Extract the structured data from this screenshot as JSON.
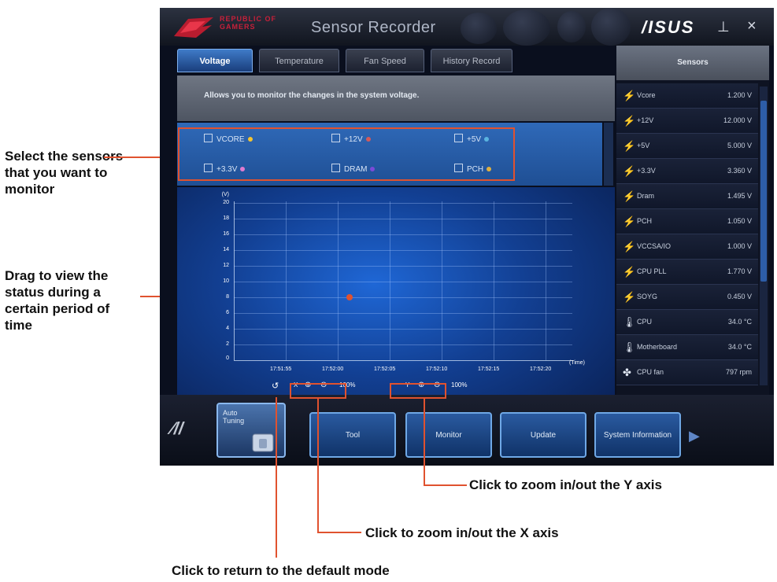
{
  "window": {
    "brand_line1": "REPUBLIC OF",
    "brand_line2": "GAMERS",
    "title": "Sensor Recorder",
    "asus_logo": "/ISUS",
    "minimize_icon": "⊥",
    "close_icon": "×"
  },
  "tabs": [
    {
      "label": "Voltage",
      "active": true
    },
    {
      "label": "Temperature"
    },
    {
      "label": "Fan Speed"
    },
    {
      "label": "History Record"
    }
  ],
  "description": "Allows you to monitor the changes in the system voltage.",
  "sensor_checkboxes": [
    {
      "label": "VCORE",
      "dot_color": "#f4c430"
    },
    {
      "label": "+12V",
      "dot_color": "#d45a5a"
    },
    {
      "label": "+5V",
      "dot_color": "#5ab4e0"
    },
    {
      "label": "+3.3V",
      "dot_color": "#e07bd0"
    },
    {
      "label": "DRAM",
      "dot_color": "#7b4ad8"
    },
    {
      "label": "PCH",
      "dot_color": "#e0b040"
    }
  ],
  "graph": {
    "y_unit": "(V)",
    "y_ticks": [
      "20",
      "18",
      "16",
      "14",
      "12",
      "10",
      "8",
      "6",
      "4",
      "2",
      "0"
    ],
    "x_ticks": [
      "17:51:55",
      "17:52:00",
      "17:52:05",
      "17:52:10",
      "17:52:15",
      "17:52:20"
    ],
    "x_unit": "(Time)",
    "reset_icon": "↺",
    "x_zoom_label": "X",
    "x_zoom_pct": "100%",
    "y_zoom_label": "Y",
    "y_zoom_pct": "100%"
  },
  "right_panel": {
    "header": "Sensors",
    "rows": [
      {
        "icon": "⚡",
        "name": "Vcore",
        "value": "1.200 V"
      },
      {
        "icon": "⚡",
        "name": "+12V",
        "value": "12.000 V"
      },
      {
        "icon": "⚡",
        "name": "+5V",
        "value": "5.000 V"
      },
      {
        "icon": "⚡",
        "name": "+3.3V",
        "value": "3.360 V"
      },
      {
        "icon": "⚡",
        "name": "Dram",
        "value": "1.495 V"
      },
      {
        "icon": "⚡",
        "name": "PCH",
        "value": "1.050 V"
      },
      {
        "icon": "⚡",
        "name": "VCCSA/IO",
        "value": "1.000 V"
      },
      {
        "icon": "⚡",
        "name": "CPU PLL",
        "value": "1.770 V"
      },
      {
        "icon": "⚡",
        "name": "SOYG",
        "value": "0.450 V"
      },
      {
        "icon": "🌡",
        "name": "CPU",
        "value": "34.0 °C"
      },
      {
        "icon": "🌡",
        "name": "Motherboard",
        "value": "34.0 °C"
      },
      {
        "icon": "✤",
        "name": "CPU fan",
        "value": "797 rpm"
      }
    ]
  },
  "bottom_bar": {
    "rog_mark": "⁄//",
    "auto_tuning": "Auto Tuning",
    "buttons": [
      "Tool",
      "Monitor",
      "Update",
      "System Information"
    ],
    "next_icon": "▶"
  },
  "annotations": {
    "select_sensors": "Select the sensors that you want to monitor",
    "drag_view": "Drag to view the status during a certain period of time",
    "zoom_y": "Click to zoom in/out the Y axis",
    "zoom_x": "Click to zoom in/out the X axis",
    "reset": "Click to return to the default mode"
  }
}
